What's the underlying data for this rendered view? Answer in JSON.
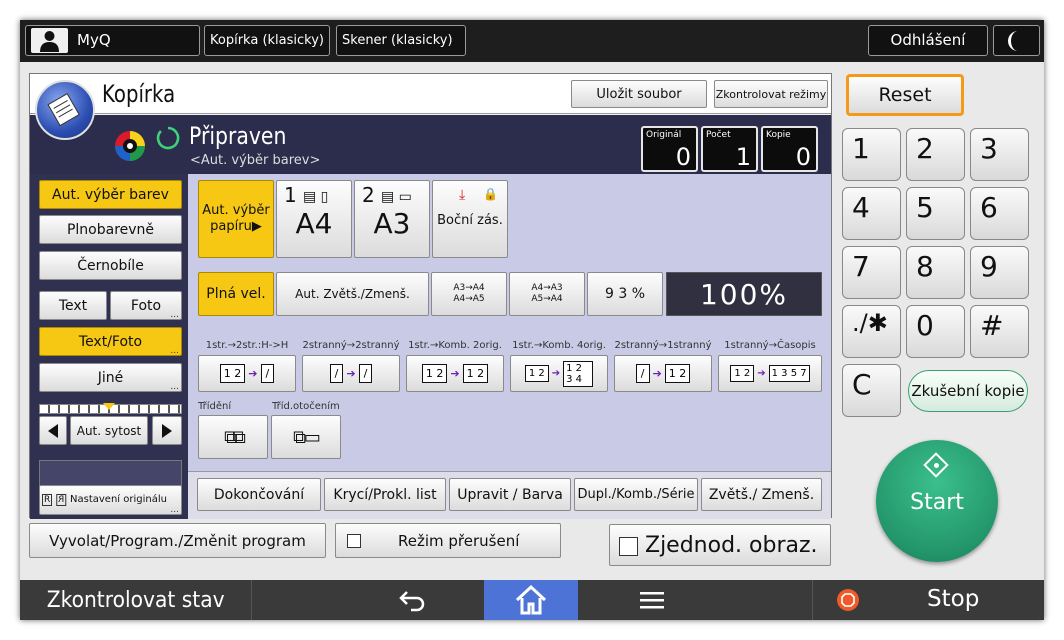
{
  "topbar": {
    "user_label": "MyQ",
    "tab_copier": "Kopírka (klasicky)",
    "tab_scanner": "Skener (klasicky)",
    "logout_label": "Odhlášení"
  },
  "header": {
    "title": "Kopírka",
    "save_file_label": "Uložit soubor",
    "check_modes_label": "Zkontrolovat režimy",
    "status": "Připraven",
    "status_sub": "<Aut. výběr barev>",
    "counters": {
      "originals_label": "Originál",
      "originals_value": "0",
      "count_label": "Počet",
      "count_value": "1",
      "copies_label": "Kopie",
      "copies_value": "0"
    }
  },
  "color_modes": {
    "auto": "Aut. výběr barev",
    "full_color": "Plnobarevně",
    "bw": "Černobíle"
  },
  "original_type": {
    "text": "Text",
    "photo": "Foto",
    "text_photo": "Text/Foto",
    "other": "Jiné"
  },
  "density": {
    "label": "Aut. sytost"
  },
  "original_settings": {
    "label": "Nastavení originálu"
  },
  "paper": {
    "auto_label": "Aut. výběr papíru▶",
    "tray1_num": "1",
    "tray1_size": "A4",
    "tray2_num": "2",
    "tray2_size": "A3",
    "bypass_label": "Boční zás."
  },
  "reduce": {
    "full_size": "Plná vel.",
    "auto_reduce": "Aut. Zvětš./Zmenš.",
    "a3_a4_top": "A3→A4",
    "a3_a4_bottom": "A4→A5",
    "a4_a3_top": "A4→A3",
    "a4_a3_bottom": "A5→A4",
    "ratio_93": "9 3 %",
    "ratio_display": "100%"
  },
  "duplex": [
    {
      "label": "1str.→2str.:H->H",
      "pages": "1 2"
    },
    {
      "label": "2stranný→2stranný",
      "pages": "1 2"
    },
    {
      "label": "1str.→Komb. 2orig.",
      "pages": "1 2"
    },
    {
      "label": "1str.→Komb. 4orig.",
      "pages": "1 2 3 4"
    },
    {
      "label": "2stranný→1stranný",
      "pages": "1 2"
    },
    {
      "label": "1stranný→Časopis",
      "pages": "1 3 5 7"
    }
  ],
  "sort": {
    "sort_label": "Třídění",
    "rotate_sort_label": "Tříd.otočením"
  },
  "tabs": {
    "finishing": "Dokončování",
    "cover": "Krycí/Prokl. list",
    "edit_color": "Upravit / Barva",
    "duplex": "Dupl./Komb./Série",
    "reduce": "Zvětš./ Zmenš."
  },
  "actions": {
    "program": "Vyvolat/Program./Změnit program",
    "interrupt": "Režim přerušení",
    "simplified": "Zjednod. obraz."
  },
  "keypad": {
    "reset": "Reset",
    "keys": [
      "1",
      "2",
      "3",
      "4",
      "5",
      "6",
      "7",
      "8",
      "9",
      "./✱",
      "0",
      "#"
    ],
    "clear": "C",
    "sample_copy": "Zkušební kopie",
    "start": "Start"
  },
  "bottombar": {
    "check_status": "Zkontrolovat stav",
    "stop": "Stop"
  },
  "colors": {
    "selected": "#f6c814",
    "start_green": "#2aa57a",
    "home_blue": "#4d73d6",
    "reset_border": "#f39a1a"
  }
}
